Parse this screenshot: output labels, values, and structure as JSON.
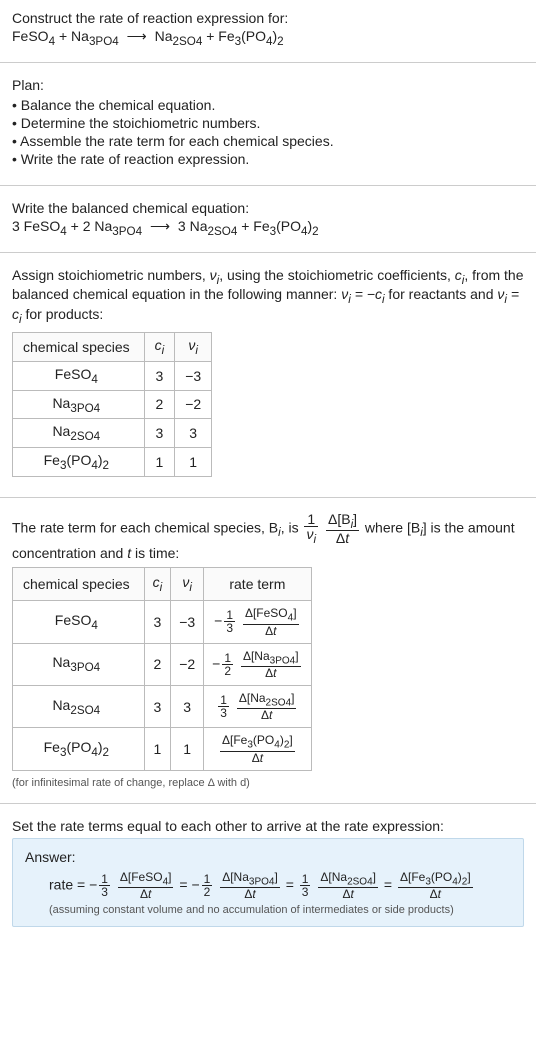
{
  "title": "Construct the rate of reaction expression for:",
  "eq_unbalanced": {
    "lhs": [
      "FeSO_4",
      "Na_3PO_4"
    ],
    "rhs": [
      "Na_2SO_4",
      "Fe3(PO4)2"
    ]
  },
  "plan": {
    "heading": "Plan:",
    "bullets": [
      "Balance the chemical equation.",
      "Determine the stoichiometric numbers.",
      "Assemble the rate term for each chemical species.",
      "Write the rate of reaction expression."
    ]
  },
  "balanced_heading": "Write the balanced chemical equation:",
  "eq_balanced": {
    "lhs": [
      {
        "coef": "3",
        "f": "FeSO_4"
      },
      {
        "coef": "2",
        "f": "Na_3PO_4"
      }
    ],
    "rhs": [
      {
        "coef": "3",
        "f": "Na_2SO_4"
      },
      {
        "coef": "",
        "f": "Fe3(PO4)2"
      }
    ]
  },
  "assign_text_1": "Assign stoichiometric numbers, ",
  "assign_text_2": ", using the stoichiometric coefficients, ",
  "assign_text_3": ", from the balanced chemical equation in the following manner: ",
  "assign_text_4": " for reactants and ",
  "assign_text_5": " for products:",
  "nu_sym": "ν_i",
  "c_sym": "c_i",
  "rel_reactants": "ν_i = −c_i",
  "rel_products": "ν_i = c_i",
  "table1": {
    "headers": [
      "chemical species",
      "c_i",
      "ν_i"
    ],
    "rows": [
      {
        "sp": "FeSO_4",
        "c": "3",
        "nu": "−3"
      },
      {
        "sp": "Na_3PO_4",
        "c": "2",
        "nu": "−2"
      },
      {
        "sp": "Na_2SO_4",
        "c": "3",
        "nu": "3"
      },
      {
        "sp": "Fe3(PO4)2",
        "c": "1",
        "nu": "1"
      }
    ]
  },
  "rate_def_1": "The rate term for each chemical species, B",
  "rate_def_2": ", is ",
  "rate_def_3": " where [B",
  "rate_def_4": "] is the amount concentration and ",
  "rate_def_5": " is time:",
  "rate_frac_num": "Δ[B_i]",
  "rate_frac_den": "Δt",
  "nu_inv": "1/ν_i",
  "t_sym": "t",
  "table2": {
    "headers": [
      "chemical species",
      "c_i",
      "ν_i",
      "rate term"
    ],
    "rows": [
      {
        "sp": "FeSO_4",
        "c": "3",
        "nu": "−3",
        "sign": "−",
        "coef": "3",
        "conc": "Δ[FeSO_4]"
      },
      {
        "sp": "Na_3PO_4",
        "c": "2",
        "nu": "−2",
        "sign": "−",
        "coef": "2",
        "conc": "Δ[Na_3PO_4]"
      },
      {
        "sp": "Na_2SO_4",
        "c": "3",
        "nu": "3",
        "sign": "",
        "coef": "3",
        "conc": "Δ[Na_2SO_4]"
      },
      {
        "sp": "Fe3(PO4)2",
        "c": "1",
        "nu": "1",
        "sign": "",
        "coef": "",
        "conc": "Δ[Fe3(PO4)_2]"
      }
    ],
    "den": "Δt"
  },
  "inf_note": "(for infinitesimal rate of change, replace Δ with d)",
  "set_equal": "Set the rate terms equal to each other to arrive at the rate expression:",
  "answer": {
    "label": "Answer:",
    "prefix": "rate = ",
    "terms": [
      {
        "sign": "−",
        "coef": "3",
        "conc": "Δ[FeSO_4]"
      },
      {
        "sign": "−",
        "coef": "2",
        "conc": "Δ[Na_3PO_4]"
      },
      {
        "sign": "",
        "coef": "3",
        "conc": "Δ[Na_2SO_4]"
      },
      {
        "sign": "",
        "coef": "",
        "conc": "Δ[Fe3(PO4)_2]"
      }
    ],
    "den": "Δt",
    "note": "(assuming constant volume and no accumulation of intermediates or side products)"
  },
  "chart_data": {
    "type": "table",
    "stoichiometry": [
      {
        "species": "FeSO4",
        "c_i": 3,
        "nu_i": -3
      },
      {
        "species": "Na3PO4",
        "c_i": 2,
        "nu_i": -2
      },
      {
        "species": "Na2SO4",
        "c_i": 3,
        "nu_i": 3
      },
      {
        "species": "Fe3(PO4)2",
        "c_i": 1,
        "nu_i": 1
      }
    ],
    "unbalanced_equation": "FeSO4 + Na3PO4 -> Na2SO4 + Fe3(PO4)2",
    "balanced_equation": "3 FeSO4 + 2 Na3PO4 -> 3 Na2SO4 + Fe3(PO4)2",
    "rate_expression": "rate = -1/3 d[FeSO4]/dt = -1/2 d[Na3PO4]/dt = 1/3 d[Na2SO4]/dt = d[Fe3(PO4)2]/dt"
  }
}
